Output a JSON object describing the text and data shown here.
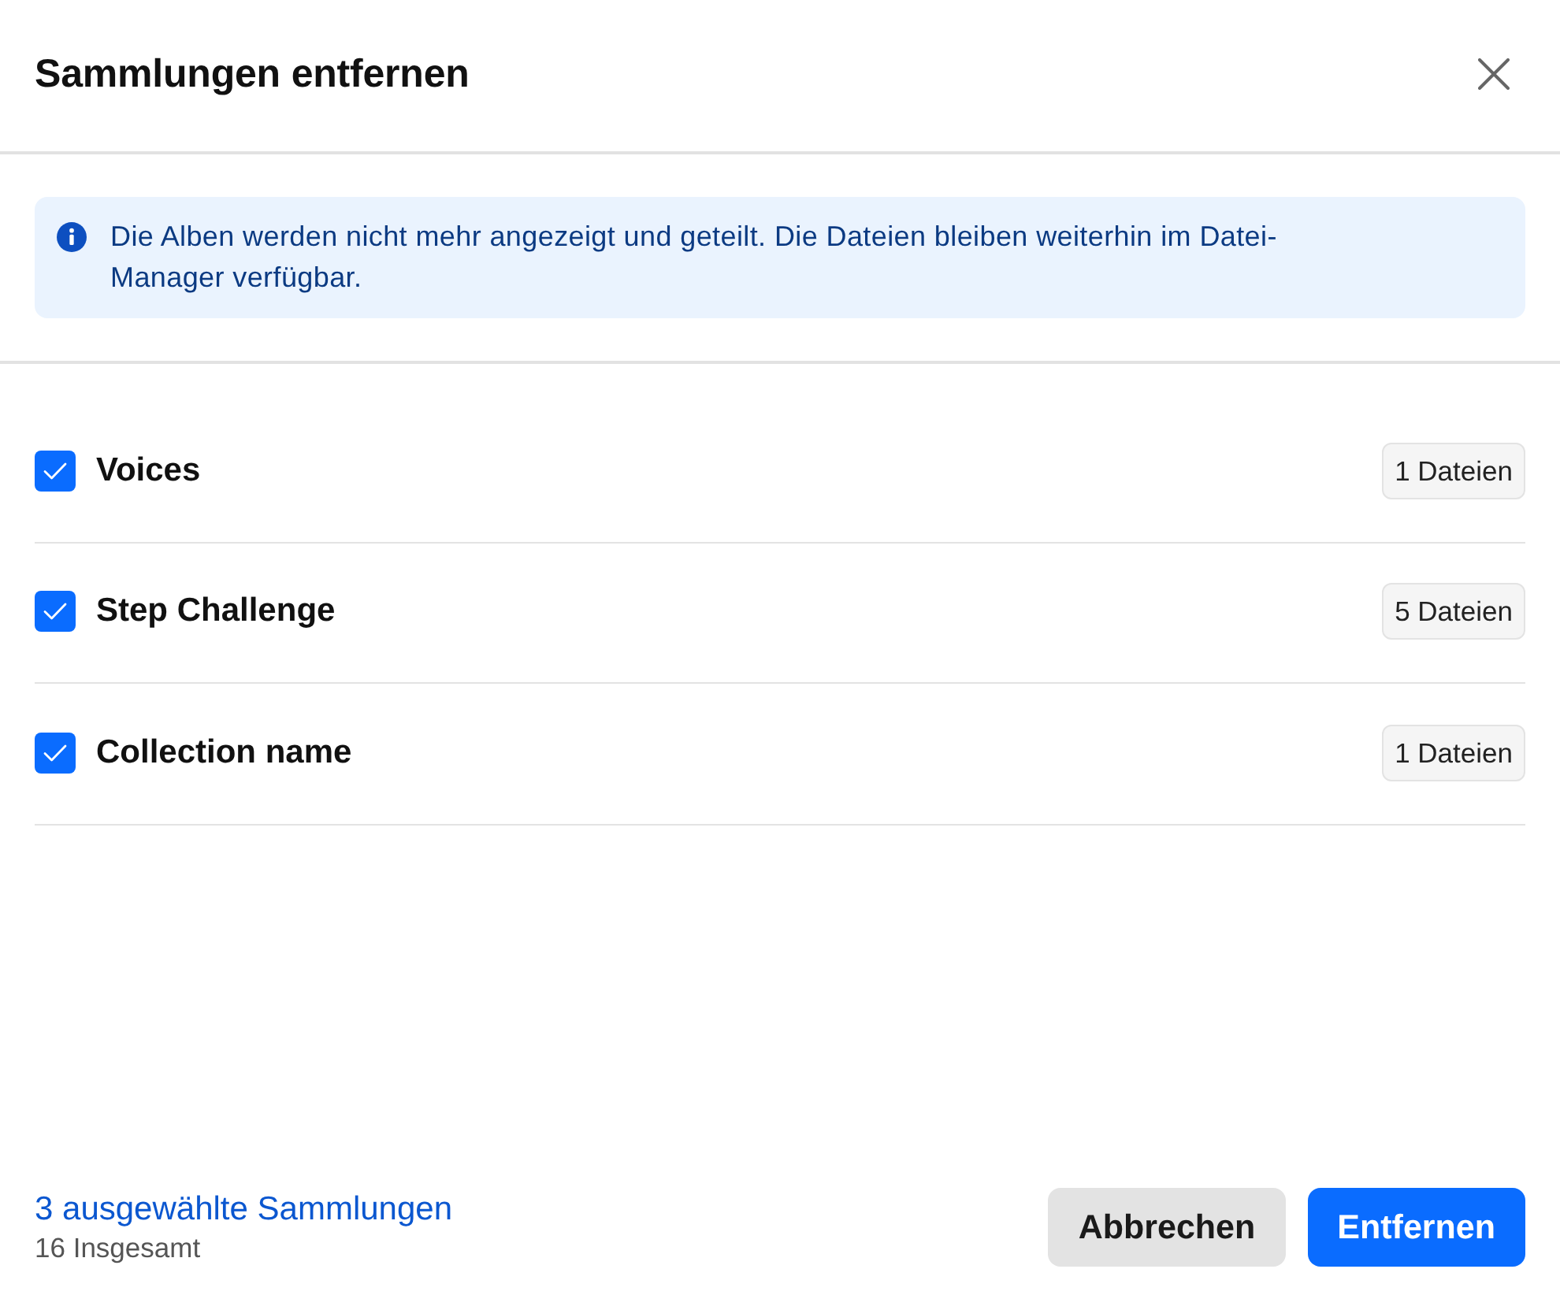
{
  "dialog": {
    "title": "Sammlungen entfernen"
  },
  "notice": {
    "text": "Die Alben werden nicht mehr angezeigt und geteilt. Die Dateien bleiben weiterhin im Datei-Manager verfügbar."
  },
  "collections": [
    {
      "name": "Voices",
      "checked": true,
      "count": "1 Dateien"
    },
    {
      "name": "Step Challenge",
      "checked": true,
      "count": "5 Dateien"
    },
    {
      "name": "Collection name",
      "checked": true,
      "count": "1 Dateien"
    }
  ],
  "footer": {
    "selected_summary": "3 ausgewählte Sammlungen",
    "total": "16 Insgesamt",
    "buttons": [
      {
        "label": "Abbrechen",
        "kind": "secondary"
      },
      {
        "label": "Entfernen",
        "kind": "primary"
      }
    ]
  }
}
